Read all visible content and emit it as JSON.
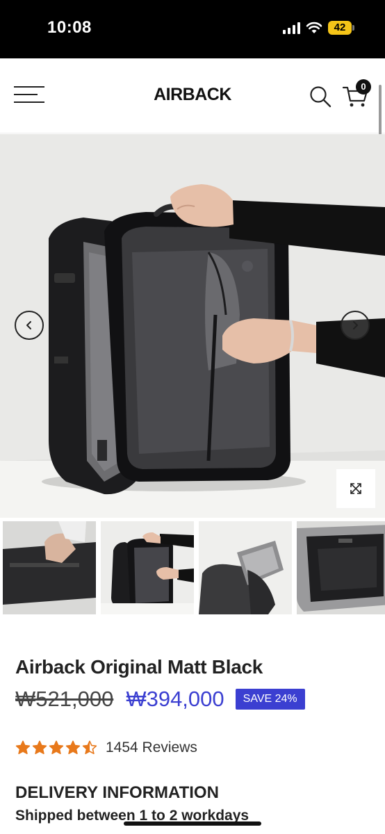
{
  "status_bar": {
    "time": "10:08",
    "battery": "42"
  },
  "header": {
    "logo": "AIRBACK",
    "cart_count": "0"
  },
  "gallery": {
    "active_index": 1,
    "thumbnail_count": 4
  },
  "product": {
    "title": "Airback Original Matt Black",
    "price_old": "₩521,000",
    "price_new": "₩394,000",
    "save_badge": "SAVE 24%",
    "rating": 4.5,
    "reviews": "1454 Reviews"
  },
  "delivery": {
    "title": "DELIVERY INFORMATION",
    "text": "Shipped between 1 to 2 workdays"
  },
  "colors": {
    "accent": "#3b3fd1",
    "star": "#e8791b",
    "text": "#222222"
  },
  "icons": [
    "menu-icon",
    "search-icon",
    "cart-icon",
    "chevron-left-icon",
    "chevron-right-icon",
    "expand-icon",
    "star-icon",
    "star-half-icon"
  ]
}
